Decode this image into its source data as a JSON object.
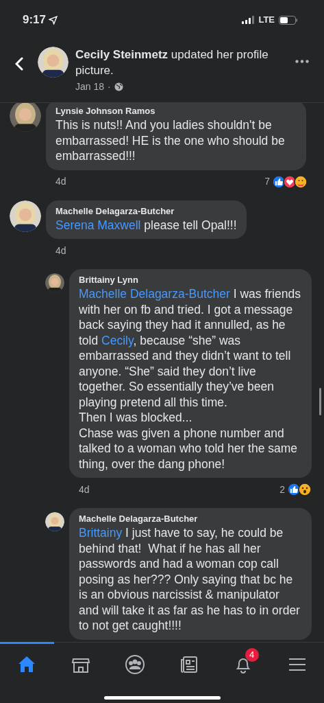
{
  "status_bar": {
    "time": "9:17",
    "network": "LTE"
  },
  "header": {
    "author": "Cecily Steinmetz",
    "action": "updated her profile picture.",
    "date": "Jan 18",
    "separator": "·"
  },
  "comments": [
    {
      "author": "Lynsie Johnson Ramos",
      "body": [
        {
          "text": "This is nuts!! And you ladies shouldn't be embarrassed! HE is the one who should be embarrassed!!!",
          "mention": false
        }
      ],
      "time": "4d",
      "reaction_count": "7",
      "reactions": [
        {
          "kind": "like"
        },
        {
          "kind": "love"
        },
        {
          "kind": "care"
        }
      ]
    },
    {
      "author": "Machelle Delagarza-Butcher",
      "body": [
        {
          "text": "Serena Maxwell",
          "mention": true
        },
        {
          "text": " please tell Opal!!!",
          "mention": false
        }
      ],
      "time": "4d",
      "children": [
        {
          "author": "Brittainy Lynn",
          "body": [
            {
              "text": "Machelle Delagarza-Butcher",
              "mention": true
            },
            {
              "text": " I was friends with her on fb and tried. I got a message back saying they had it annulled, as he told ",
              "mention": false
            },
            {
              "text": "Cecily",
              "mention": true
            },
            {
              "text": ", because “she” was embarrassed and they didn’t want to tell anyone. “She” said they don’t live together. So essentially they’ve been playing pretend all this time.\nThen I was blocked...\nChase was given a phone number and talked to a woman who told her the same thing, over the dang phone!",
              "mention": false
            }
          ],
          "time": "4d",
          "reaction_count": "2",
          "reactions": [
            {
              "kind": "like"
            },
            {
              "kind": "wow"
            }
          ]
        },
        {
          "author": "Machelle Delagarza-Butcher",
          "body": [
            {
              "text": "Brittainy",
              "mention": true
            },
            {
              "text": " I just have to say, he could be behind that!  What if he has all her passwords and had a woman cop call posing as her??? Only saying that bc he is an obvious narcissist & manipulator and will take it as far as he has to in order to not get caught!!!!",
              "mention": false
            }
          ]
        }
      ]
    }
  ],
  "tab_bar": [
    {
      "kind": "home",
      "selected": true
    },
    {
      "kind": "marketplace",
      "selected": false
    },
    {
      "kind": "groups",
      "selected": false
    },
    {
      "kind": "news",
      "selected": false
    },
    {
      "kind": "notifications",
      "selected": false,
      "badge": "4"
    },
    {
      "kind": "menu",
      "selected": false
    }
  ]
}
